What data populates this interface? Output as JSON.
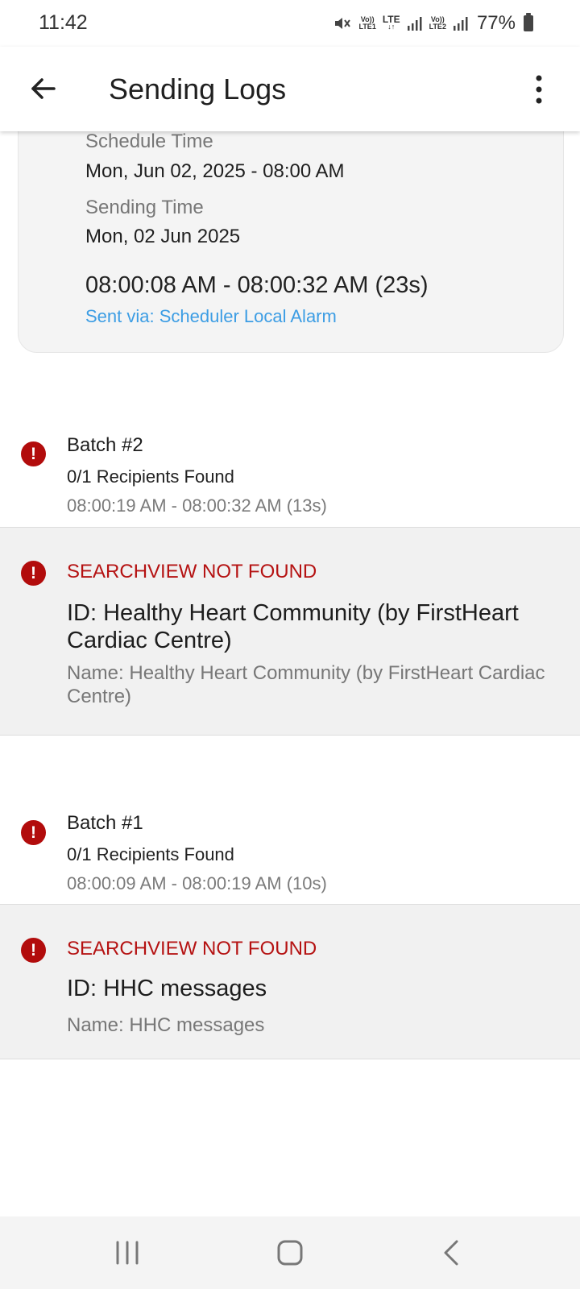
{
  "status_bar": {
    "time": "11:42",
    "sim1_top": "Vo))",
    "sim1_bottom": "LTE1",
    "lte_top": "LTE",
    "lte_bottom": "↓↑",
    "sim2_top": "Vo))",
    "sim2_bottom": "LTE2",
    "battery": "77%"
  },
  "app_bar": {
    "title": "Sending Logs"
  },
  "summary": {
    "schedule_label": "Schedule Time",
    "schedule_value": "Mon, Jun 02, 2025 - 08:00 AM",
    "sending_label": "Sending Time",
    "sending_date": "Mon, 02 Jun 2025",
    "time_range": "08:00:08 AM - 08:00:32 AM (23s)",
    "sent_via": "Sent via: Scheduler Local Alarm"
  },
  "batches": [
    {
      "title": "Batch #2",
      "found": "0/1 Recipients Found",
      "time": "08:00:19 AM - 08:00:32 AM (13s)",
      "error": {
        "title": "SEARCHVIEW NOT FOUND",
        "id": "ID: Healthy Heart Community (by FirstHeart Cardiac Centre)",
        "name": "Name: Healthy Heart Community (by FirstHeart Cardiac Centre)"
      }
    },
    {
      "title": "Batch #1",
      "found": "0/1 Recipients Found",
      "time": "08:00:09 AM - 08:00:19 AM (10s)",
      "error": {
        "title": "SEARCHVIEW NOT FOUND",
        "id": "ID: HHC messages",
        "name": "Name: HHC messages"
      }
    }
  ],
  "icons": {
    "error": "!",
    "back": "arrow-back-icon",
    "more": "more-vertical-icon"
  },
  "colors": {
    "error_red": "#b20c0c",
    "link_blue": "#3c9de4"
  }
}
